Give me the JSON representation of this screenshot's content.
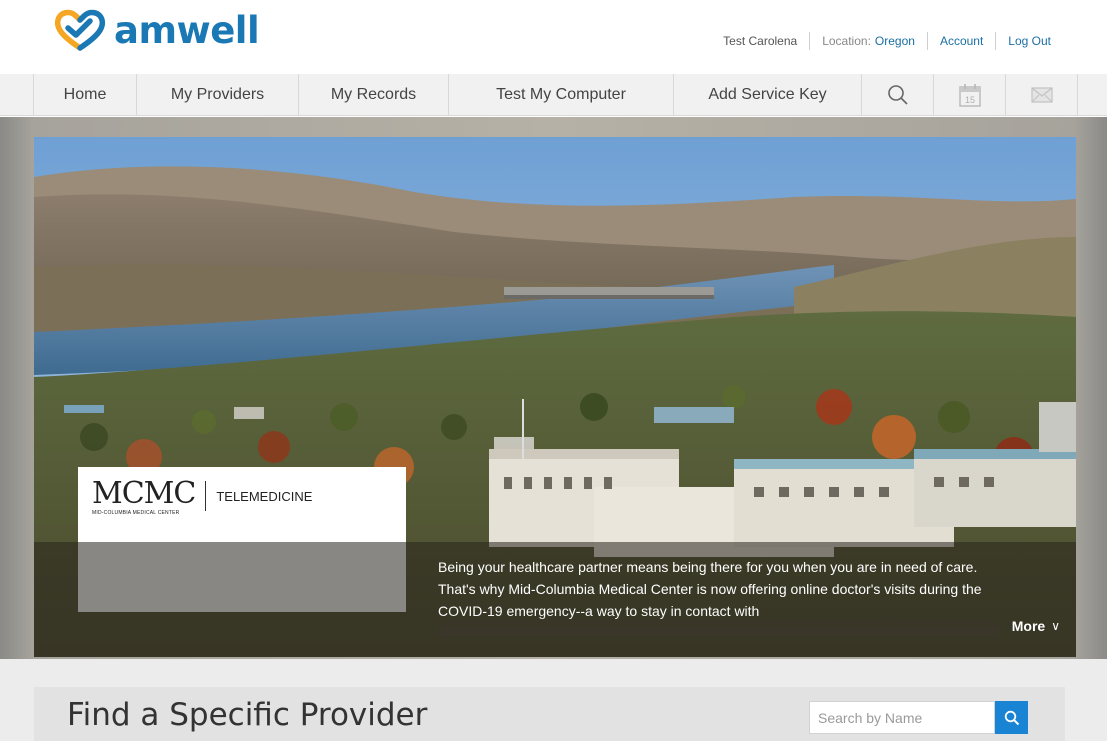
{
  "brand": {
    "name": "amwell",
    "color": "#1a78b4",
    "heart_color_a": "#f5a623",
    "heart_color_b": "#1a78b4"
  },
  "utility": {
    "user_name": "Test Carolena",
    "location_label": "Location:",
    "location_value": "Oregon",
    "account": "Account",
    "logout": "Log Out"
  },
  "nav": {
    "items": [
      {
        "label": "Home"
      },
      {
        "label": "My Providers"
      },
      {
        "label": "My Records"
      },
      {
        "label": "Test My Computer"
      },
      {
        "label": "Add Service Key"
      }
    ],
    "icons": [
      "search-icon",
      "calendar-icon",
      "mail-icon"
    ],
    "calendar_day": "15"
  },
  "hero": {
    "partner_logo_mark": "MCMC",
    "partner_logo_sub": "MID-COLUMBIA MEDICAL CENTER",
    "partner_tag": "TELEMEDICINE",
    "caption": "Being your healthcare partner means being there for you when you are in need of care. That's why Mid-Columbia Medical Center is now offering online doctor's visits during the COVID-19 emergency--a way to stay in contact with",
    "more_label": "More"
  },
  "find_provider": {
    "title": "Find a Specific Provider",
    "search_placeholder": "Search by Name",
    "search_button_color": "#1a84d4"
  }
}
